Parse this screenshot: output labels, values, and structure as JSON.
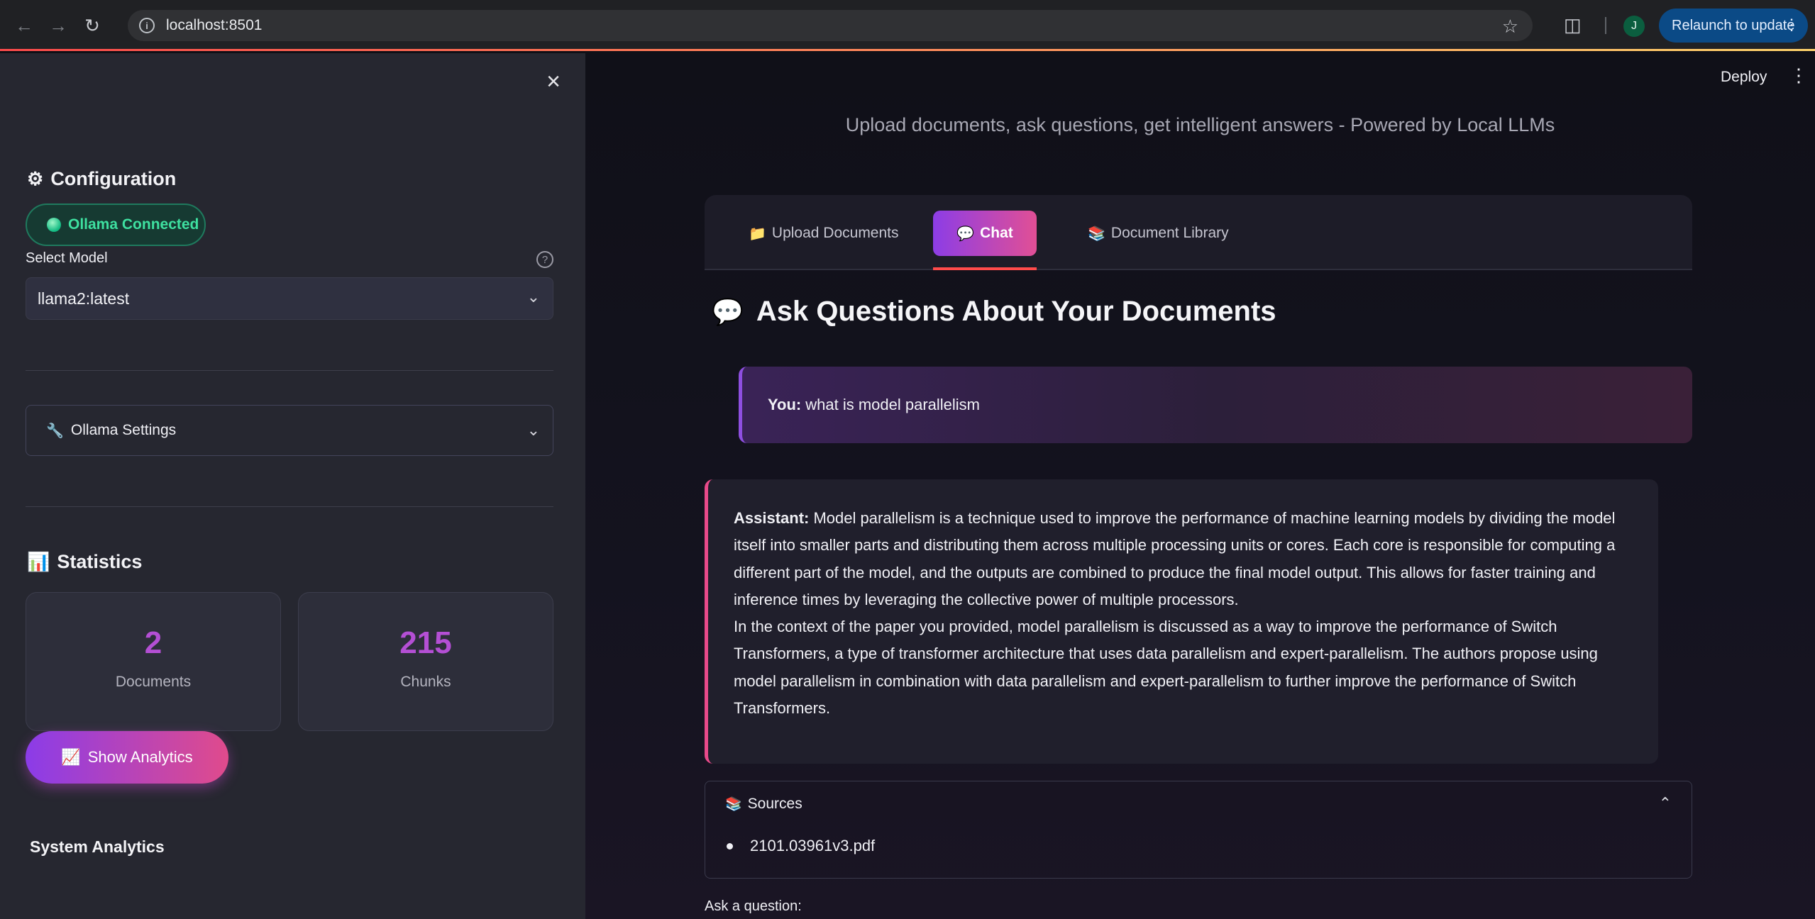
{
  "browser": {
    "url": "localhost:8501",
    "profile_initial": "J",
    "relaunch_label": "Relaunch to update"
  },
  "sidebar": {
    "config_title": "Configuration",
    "status_label": "Ollama Connected",
    "model_label": "Select Model",
    "model_value": "llama2:latest",
    "ollama_settings_label": "Ollama Settings",
    "statistics_title": "Statistics",
    "stats": [
      {
        "value": "2",
        "label": "Documents"
      },
      {
        "value": "215",
        "label": "Chunks"
      }
    ],
    "show_analytics_label": "Show Analytics",
    "system_analytics_title": "System Analytics"
  },
  "main": {
    "deploy_label": "Deploy",
    "subtitle": "Upload documents, ask questions, get intelligent answers - Powered by Local LLMs",
    "tabs": [
      {
        "label": "Upload Documents"
      },
      {
        "label": "Chat"
      },
      {
        "label": "Document Library"
      }
    ],
    "section_title": "Ask Questions About Your Documents",
    "user_message": {
      "speaker": "You:",
      "text": "what is model parallelism"
    },
    "assistant_message": {
      "speaker": "Assistant:",
      "paragraph1": "Model parallelism is a technique used to improve the performance of machine learning models by dividing the model itself into smaller parts and distributing them across multiple processing units or cores. Each core is responsible for computing a different part of the model, and the outputs are combined to produce the final model output. This allows for faster training and inference times by leveraging the collective power of multiple processors.",
      "paragraph2": "In the context of the paper you provided, model parallelism is discussed as a way to improve the performance of Switch Transformers, a type of transformer architecture that uses data parallelism and expert-parallelism. The authors propose using model parallelism in combination with data parallelism and expert-parallelism to further improve the performance of Switch Transformers."
    },
    "sources": {
      "title": "Sources",
      "items": [
        "2101.03961v3.pdf"
      ]
    },
    "ask_label": "Ask a question:"
  },
  "colors": {
    "accent_gradient_start": "#8b3ce8",
    "accent_gradient_end": "#e04b8c",
    "status_green": "#3ee0a0",
    "stat_value": "#b44fd4",
    "tab_underline": "#ff4b4b"
  }
}
